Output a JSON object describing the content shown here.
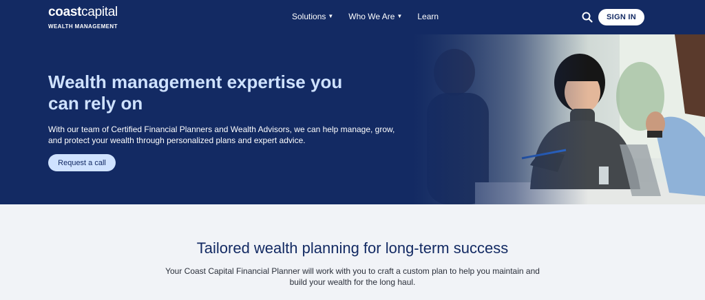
{
  "brand": {
    "logo_bold": "coast",
    "logo_light": "capital",
    "logo_sub": "WEALTH MANAGEMENT"
  },
  "nav": {
    "items": [
      {
        "label": "Solutions",
        "has_dropdown": true
      },
      {
        "label": "Who We Are",
        "has_dropdown": true
      },
      {
        "label": "Learn",
        "has_dropdown": false
      }
    ],
    "signin_label": "SIGN IN",
    "search_icon": "search-icon"
  },
  "hero": {
    "title": "Wealth management expertise you can rely on",
    "description": "With our team of Certified Financial Planners and Wealth Advisors, we can help manage, grow, and protect your wealth through personalized plans and expert advice.",
    "cta_label": "Request a call"
  },
  "section": {
    "title": "Tailored wealth planning for long-term success",
    "description": "Your Coast Capital Financial Planner will work with you to craft a custom plan to help you maintain and build your wealth for the long haul."
  },
  "colors": {
    "navy": "#132a63",
    "light_blue": "#cfe2ff",
    "page_bg": "#f1f3f7"
  }
}
